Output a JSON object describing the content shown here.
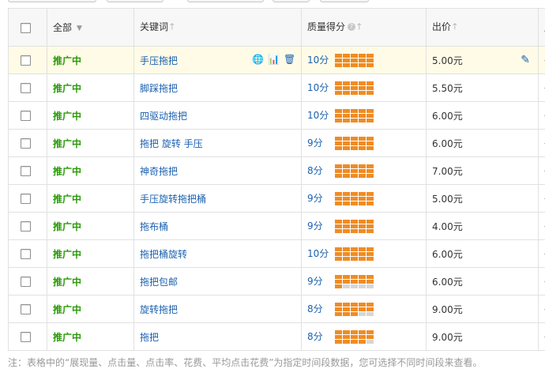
{
  "header": {
    "status_col": "全部",
    "keyword_col": "关键词",
    "quality_col": "质量得分",
    "price_col": "出价",
    "next_col": "展"
  },
  "rows": [
    {
      "status": "推广中",
      "keyword": "手压拖把",
      "score": "10分",
      "level": 15,
      "price": "5.00元",
      "extra": "-"
    },
    {
      "status": "推广中",
      "keyword": "脚踩拖把",
      "score": "10分",
      "level": 15,
      "price": "5.50元",
      "extra": "-"
    },
    {
      "status": "推广中",
      "keyword": "四驱动拖把",
      "score": "10分",
      "level": 15,
      "price": "6.00元",
      "extra": "-"
    },
    {
      "status": "推广中",
      "keyword": "拖把 旋转 手压",
      "score": "9分",
      "level": 15,
      "price": "6.00元",
      "extra": "-"
    },
    {
      "status": "推广中",
      "keyword": "神奇拖把",
      "score": "8分",
      "level": 15,
      "price": "7.00元",
      "extra": "-"
    },
    {
      "status": "推广中",
      "keyword": "手压旋转拖把桶",
      "score": "9分",
      "level": 15,
      "price": "5.00元",
      "extra": "-"
    },
    {
      "status": "推广中",
      "keyword": "拖布桶",
      "score": "9分",
      "level": 15,
      "price": "4.00元",
      "extra": "-"
    },
    {
      "status": "推广中",
      "keyword": "拖把桶旋转",
      "score": "10分",
      "level": 15,
      "price": "6.00元",
      "extra": "-"
    },
    {
      "status": "推广中",
      "keyword": "拖把包邮",
      "score": "9分",
      "level": 11,
      "price": "6.00元",
      "extra": "-"
    },
    {
      "status": "推广中",
      "keyword": "旋转拖把",
      "score": "8分",
      "level": 13,
      "price": "9.00元",
      "extra": "-"
    },
    {
      "status": "推广中",
      "keyword": "拖把",
      "score": "8分",
      "level": 14,
      "price": "9.00元",
      "extra": "-"
    }
  ],
  "footer_note": "注：表格中的“展现量、点击量、点击率、花费、平均点击花费”为指定时间段数据，您可选择不同时间段来查看。",
  "colors": {
    "status_green": "#2a9a08",
    "link_blue": "#1b61b0",
    "bar_orange": "#ef8c24",
    "bar_gray": "#d6d6d6",
    "highlight_row": "#fffbe6"
  },
  "icons": {
    "globe": "globe-icon",
    "chart": "chart-icon",
    "delete": "trash-icon",
    "edit": "pencil-icon"
  }
}
